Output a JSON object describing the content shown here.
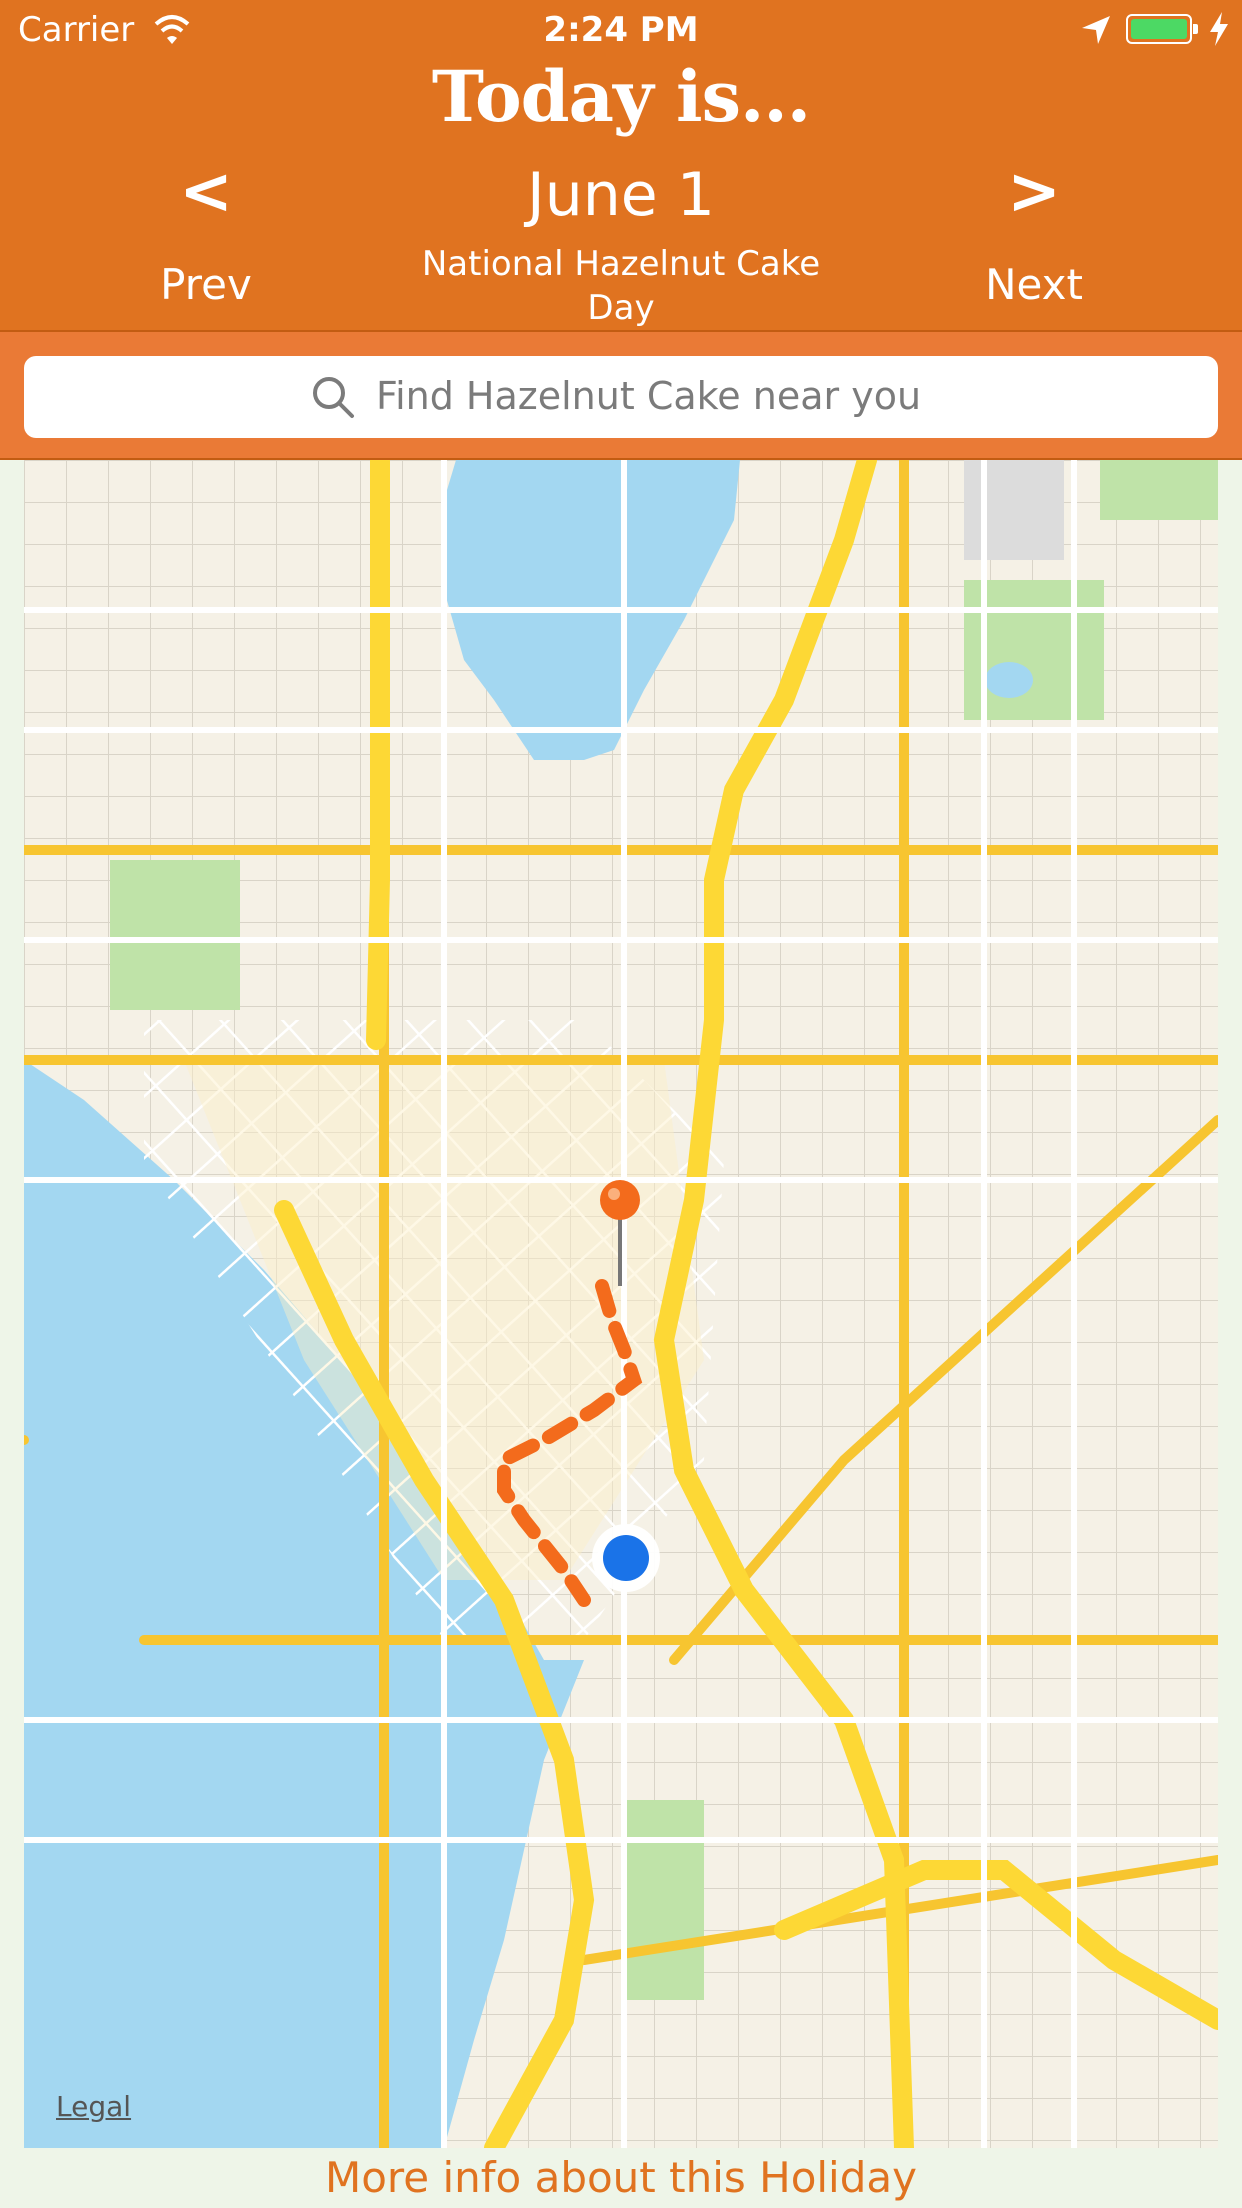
{
  "status_bar": {
    "carrier": "Carrier",
    "time": "2:24 PM"
  },
  "header": {
    "title": "Today is...",
    "date": "June 1",
    "holiday": "National Hazelnut Cake Day",
    "prev_arrow": "<",
    "prev_label": "Prev",
    "next_arrow": ">",
    "next_label": "Next"
  },
  "search": {
    "placeholder": "Find Hazelnut Cake near you"
  },
  "map": {
    "legal": "Legal"
  },
  "footer": {
    "more_info": "More info about this Holiday"
  },
  "colors": {
    "header": "#e07320",
    "accent": "#e07320",
    "water": "#a3d7f1",
    "user_location": "#1a73e8"
  }
}
